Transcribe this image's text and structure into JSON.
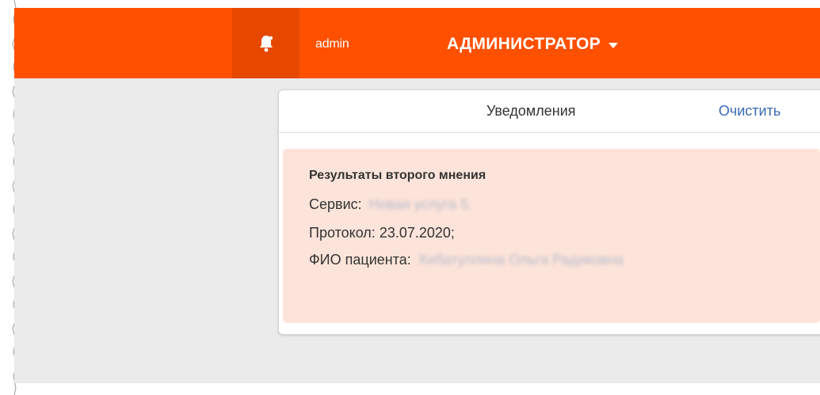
{
  "header": {
    "bell_icon": "bell-icon",
    "username": "admin",
    "role": "АДМИНИСТРАТОР",
    "accent_color": "#ff5000"
  },
  "notifications": {
    "title": "Уведомления",
    "clear_label": "Очистить",
    "items": [
      {
        "heading": "Результаты второго мнения",
        "service_label": "Сервис:",
        "service_value": "Новая услуга 5.",
        "protocol_label": "Протокол:",
        "protocol_value": "23.07.2020;",
        "patient_label": "ФИО пациента:",
        "patient_value": "Хибатуллина Ольга Радиковна",
        "background_color": "#fde4da"
      }
    ]
  }
}
